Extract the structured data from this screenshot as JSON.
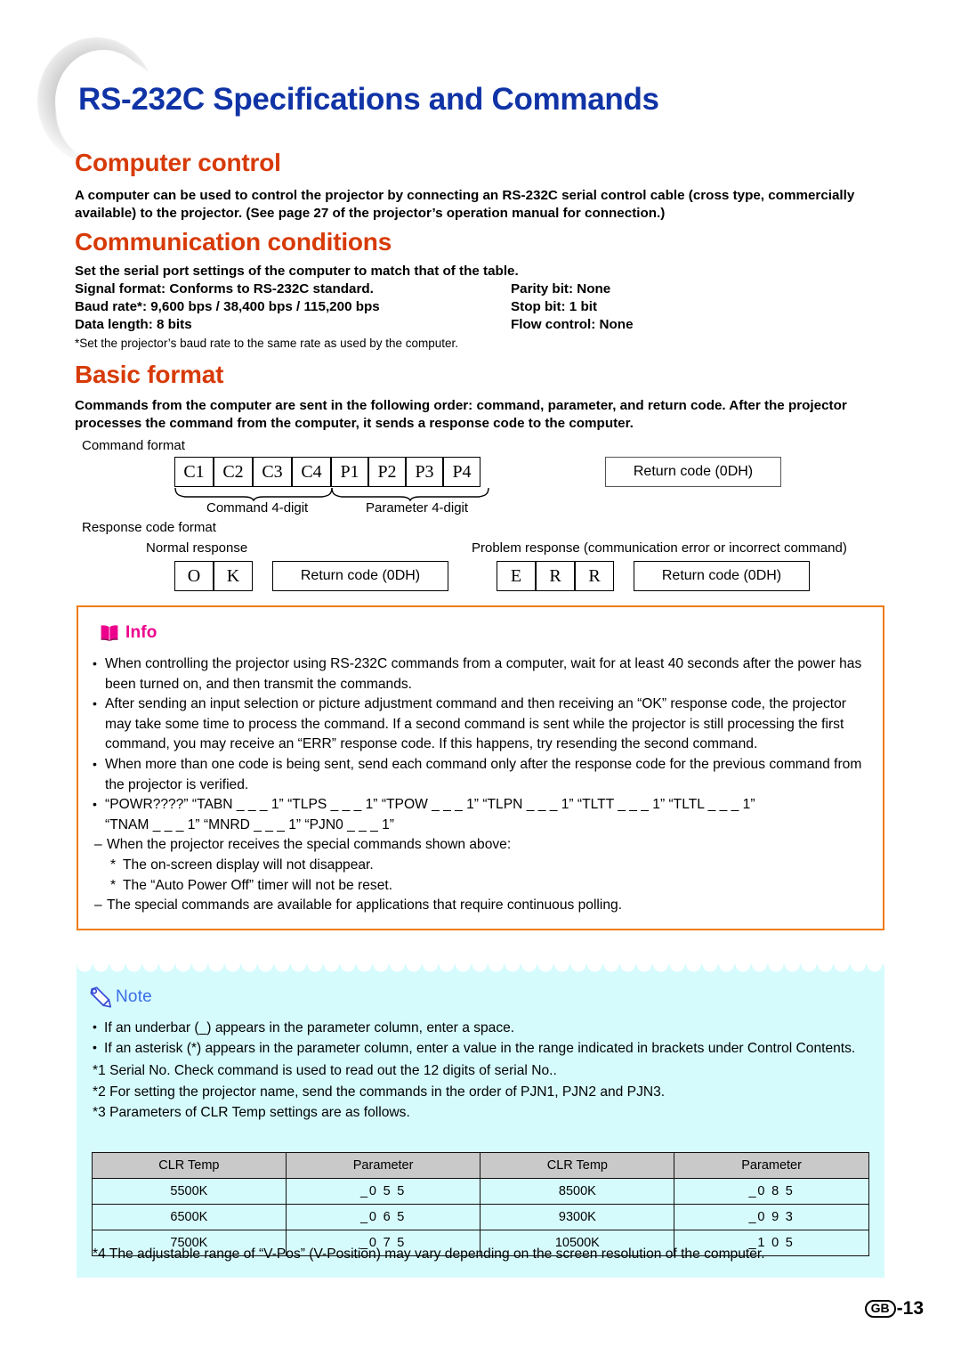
{
  "document": {
    "title": "RS-232C Specifications and Commands",
    "page_footer": {
      "region_code": "GB",
      "page_number": "-13"
    }
  },
  "sections": {
    "computer_control": {
      "heading": "Computer control",
      "paragraph": "A computer can be used to control the projector by connecting an RS-232C serial control cable (cross type, commercially available) to the projector. (See page 27 of the projector’s operation manual for connection.)"
    },
    "communication_conditions": {
      "heading": "Communication conditions",
      "intro": "Set the serial port settings of the computer to match that of the table.",
      "rows": [
        {
          "left": "Signal format: Conforms to RS-232C standard.",
          "right": "Parity bit: None"
        },
        {
          "left": "Baud rate*: 9,600 bps / 38,400 bps / 115,200 bps",
          "right": "Stop bit: 1 bit"
        },
        {
          "left": "Data length: 8 bits",
          "right": "Flow control: None"
        }
      ],
      "footnote": "*Set the projector’s baud rate to the same rate as used by the computer."
    },
    "basic_format": {
      "heading": "Basic format",
      "paragraph": "Commands from the computer are sent in the following order: command, parameter, and return code. After the projector processes the command from the computer, it sends a response code to the computer.",
      "command_format_label": "Command format",
      "command_cells": [
        "C1",
        "C2",
        "C3",
        "C4",
        "P1",
        "P2",
        "P3",
        "P4"
      ],
      "command_brace_label": "Command 4-digit",
      "parameter_brace_label": "Parameter 4-digit",
      "return_code_label": "Return code (0DH)",
      "response_code_format_label": "Response code format",
      "normal_response_label": "Normal response",
      "normal_response_cells": [
        "O",
        "K"
      ],
      "normal_return_code_label": "Return code (0DH)",
      "problem_response_label": "Problem response (communication error or incorrect command)",
      "problem_response_cells": [
        "E",
        "R",
        "R"
      ],
      "problem_return_code_label": "Return code (0DH)"
    }
  },
  "info_box": {
    "icon": "book-icon",
    "title": "Info",
    "accent_color": "#f07c11",
    "title_color": "#ec008c",
    "items": [
      "When controlling the projector using RS-232C commands from a computer, wait for at least 40 seconds after the power has been turned on, and then transmit the commands.",
      "After sending an input selection or picture adjustment command and then receiving an “OK” response code, the projector may take some time to process the command. If a second command is sent while the projector is still processing the first command, you may receive an “ERR” response code. If this happens, try resending the second command.",
      "When more than one code is being sent, send each command only after the response code for the previous command from the projector is verified."
    ],
    "special_commands_line1": "“POWR????” “TABN _ _ _ 1” “TLPS _ _ _ 1” “TPOW _ _ _ 1” “TLPN _ _ _ 1” “TLTT _ _ _ 1” “TLTL _ _ _ 1”",
    "special_commands_line2": "“TNAM _ _ _ 1” “MNRD _ _ _ 1” “PJN0 _ _ _ 1”",
    "sub_items": [
      "When the projector receives the special commands shown above:",
      "The on-screen display will not disappear.",
      "The “Auto Power Off” timer will not be reset.",
      "The special commands are available for applications that require continuous polling."
    ]
  },
  "note_box": {
    "icon": "pencil-icon",
    "title": "Note",
    "background_color": "#d6fbfd",
    "title_color": "#3a6ee8",
    "items": [
      "If an underbar (_) appears in the parameter column, enter a space.",
      "If an asterisk (*) appears in the parameter column, enter a value in the range indicated in brackets under Control Contents."
    ],
    "numbered_notes": [
      "*1 Serial No. Check command is used to read out the 12 digits of serial No..",
      "*2 For setting the projector name, send the commands in the order of PJN1, PJN2 and PJN3.",
      "*3 Parameters of CLR Temp settings are as follows."
    ],
    "footnote": "*4 The adjustable range of “V-Pos” (V-Position) may vary depending on the screen resolution of the computer."
  },
  "clr_temp_table": {
    "headers": [
      "CLR Temp",
      "Parameter",
      "CLR Temp",
      "Parameter"
    ],
    "rows": [
      [
        "5500K",
        "_0 5 5",
        "8500K",
        "_0 8 5"
      ],
      [
        "6500K",
        "_0 6 5",
        "9300K",
        "_0 9 3"
      ],
      [
        "7500K",
        "_0 7 5",
        "10500K",
        "_1 0 5"
      ]
    ]
  }
}
